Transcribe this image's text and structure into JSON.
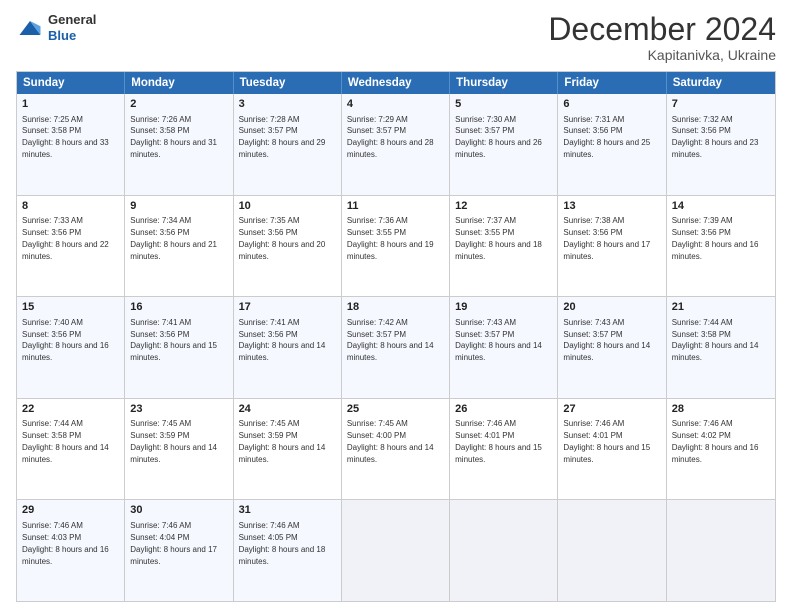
{
  "header": {
    "logo_general": "General",
    "logo_blue": "Blue",
    "month_title": "December 2024",
    "location": "Kapitanivka, Ukraine"
  },
  "weekdays": [
    "Sunday",
    "Monday",
    "Tuesday",
    "Wednesday",
    "Thursday",
    "Friday",
    "Saturday"
  ],
  "rows": [
    [
      {
        "day": "1",
        "sunrise": "Sunrise: 7:25 AM",
        "sunset": "Sunset: 3:58 PM",
        "daylight": "Daylight: 8 hours and 33 minutes."
      },
      {
        "day": "2",
        "sunrise": "Sunrise: 7:26 AM",
        "sunset": "Sunset: 3:58 PM",
        "daylight": "Daylight: 8 hours and 31 minutes."
      },
      {
        "day": "3",
        "sunrise": "Sunrise: 7:28 AM",
        "sunset": "Sunset: 3:57 PM",
        "daylight": "Daylight: 8 hours and 29 minutes."
      },
      {
        "day": "4",
        "sunrise": "Sunrise: 7:29 AM",
        "sunset": "Sunset: 3:57 PM",
        "daylight": "Daylight: 8 hours and 28 minutes."
      },
      {
        "day": "5",
        "sunrise": "Sunrise: 7:30 AM",
        "sunset": "Sunset: 3:57 PM",
        "daylight": "Daylight: 8 hours and 26 minutes."
      },
      {
        "day": "6",
        "sunrise": "Sunrise: 7:31 AM",
        "sunset": "Sunset: 3:56 PM",
        "daylight": "Daylight: 8 hours and 25 minutes."
      },
      {
        "day": "7",
        "sunrise": "Sunrise: 7:32 AM",
        "sunset": "Sunset: 3:56 PM",
        "daylight": "Daylight: 8 hours and 23 minutes."
      }
    ],
    [
      {
        "day": "8",
        "sunrise": "Sunrise: 7:33 AM",
        "sunset": "Sunset: 3:56 PM",
        "daylight": "Daylight: 8 hours and 22 minutes."
      },
      {
        "day": "9",
        "sunrise": "Sunrise: 7:34 AM",
        "sunset": "Sunset: 3:56 PM",
        "daylight": "Daylight: 8 hours and 21 minutes."
      },
      {
        "day": "10",
        "sunrise": "Sunrise: 7:35 AM",
        "sunset": "Sunset: 3:56 PM",
        "daylight": "Daylight: 8 hours and 20 minutes."
      },
      {
        "day": "11",
        "sunrise": "Sunrise: 7:36 AM",
        "sunset": "Sunset: 3:55 PM",
        "daylight": "Daylight: 8 hours and 19 minutes."
      },
      {
        "day": "12",
        "sunrise": "Sunrise: 7:37 AM",
        "sunset": "Sunset: 3:55 PM",
        "daylight": "Daylight: 8 hours and 18 minutes."
      },
      {
        "day": "13",
        "sunrise": "Sunrise: 7:38 AM",
        "sunset": "Sunset: 3:56 PM",
        "daylight": "Daylight: 8 hours and 17 minutes."
      },
      {
        "day": "14",
        "sunrise": "Sunrise: 7:39 AM",
        "sunset": "Sunset: 3:56 PM",
        "daylight": "Daylight: 8 hours and 16 minutes."
      }
    ],
    [
      {
        "day": "15",
        "sunrise": "Sunrise: 7:40 AM",
        "sunset": "Sunset: 3:56 PM",
        "daylight": "Daylight: 8 hours and 16 minutes."
      },
      {
        "day": "16",
        "sunrise": "Sunrise: 7:41 AM",
        "sunset": "Sunset: 3:56 PM",
        "daylight": "Daylight: 8 hours and 15 minutes."
      },
      {
        "day": "17",
        "sunrise": "Sunrise: 7:41 AM",
        "sunset": "Sunset: 3:56 PM",
        "daylight": "Daylight: 8 hours and 14 minutes."
      },
      {
        "day": "18",
        "sunrise": "Sunrise: 7:42 AM",
        "sunset": "Sunset: 3:57 PM",
        "daylight": "Daylight: 8 hours and 14 minutes."
      },
      {
        "day": "19",
        "sunrise": "Sunrise: 7:43 AM",
        "sunset": "Sunset: 3:57 PM",
        "daylight": "Daylight: 8 hours and 14 minutes."
      },
      {
        "day": "20",
        "sunrise": "Sunrise: 7:43 AM",
        "sunset": "Sunset: 3:57 PM",
        "daylight": "Daylight: 8 hours and 14 minutes."
      },
      {
        "day": "21",
        "sunrise": "Sunrise: 7:44 AM",
        "sunset": "Sunset: 3:58 PM",
        "daylight": "Daylight: 8 hours and 14 minutes."
      }
    ],
    [
      {
        "day": "22",
        "sunrise": "Sunrise: 7:44 AM",
        "sunset": "Sunset: 3:58 PM",
        "daylight": "Daylight: 8 hours and 14 minutes."
      },
      {
        "day": "23",
        "sunrise": "Sunrise: 7:45 AM",
        "sunset": "Sunset: 3:59 PM",
        "daylight": "Daylight: 8 hours and 14 minutes."
      },
      {
        "day": "24",
        "sunrise": "Sunrise: 7:45 AM",
        "sunset": "Sunset: 3:59 PM",
        "daylight": "Daylight: 8 hours and 14 minutes."
      },
      {
        "day": "25",
        "sunrise": "Sunrise: 7:45 AM",
        "sunset": "Sunset: 4:00 PM",
        "daylight": "Daylight: 8 hours and 14 minutes."
      },
      {
        "day": "26",
        "sunrise": "Sunrise: 7:46 AM",
        "sunset": "Sunset: 4:01 PM",
        "daylight": "Daylight: 8 hours and 15 minutes."
      },
      {
        "day": "27",
        "sunrise": "Sunrise: 7:46 AM",
        "sunset": "Sunset: 4:01 PM",
        "daylight": "Daylight: 8 hours and 15 minutes."
      },
      {
        "day": "28",
        "sunrise": "Sunrise: 7:46 AM",
        "sunset": "Sunset: 4:02 PM",
        "daylight": "Daylight: 8 hours and 16 minutes."
      }
    ],
    [
      {
        "day": "29",
        "sunrise": "Sunrise: 7:46 AM",
        "sunset": "Sunset: 4:03 PM",
        "daylight": "Daylight: 8 hours and 16 minutes."
      },
      {
        "day": "30",
        "sunrise": "Sunrise: 7:46 AM",
        "sunset": "Sunset: 4:04 PM",
        "daylight": "Daylight: 8 hours and 17 minutes."
      },
      {
        "day": "31",
        "sunrise": "Sunrise: 7:46 AM",
        "sunset": "Sunset: 4:05 PM",
        "daylight": "Daylight: 8 hours and 18 minutes."
      },
      null,
      null,
      null,
      null
    ]
  ]
}
